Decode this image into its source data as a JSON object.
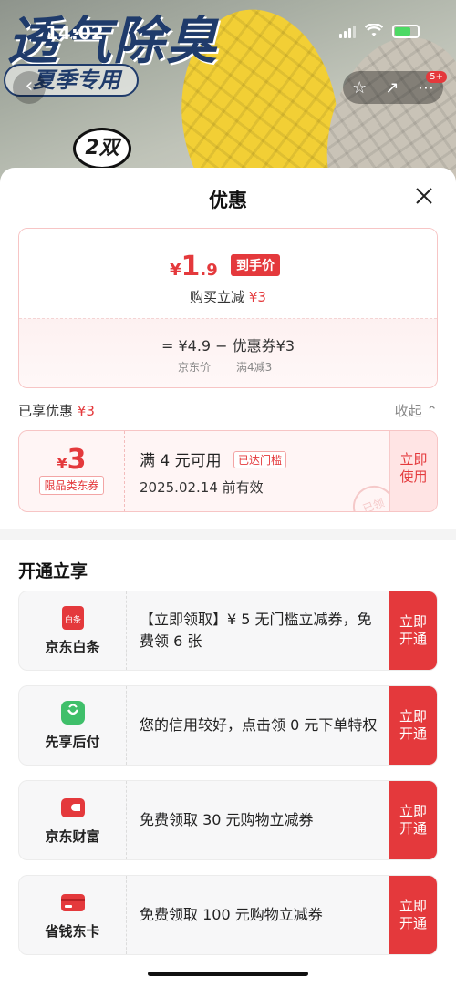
{
  "status_bar": {
    "time": "14:02"
  },
  "hero": {
    "title": "透气除臭",
    "season_tag": "夏季专用",
    "pair_badge": "2双",
    "message_badge": "5+"
  },
  "sheet": {
    "title": "优惠",
    "price": {
      "yen": "¥",
      "int": "1",
      "dec": ".9",
      "tag": "到手价",
      "buy_reduce_label": "购买立减",
      "buy_reduce_value": "¥3",
      "calc": "= ¥4.9 − 优惠券¥3",
      "calc_sub_left": "京东价",
      "calc_sub_right": "满4减3"
    },
    "enjoyed": {
      "label": "已享优惠",
      "value": "¥3",
      "collapse": "收起 ⌃"
    },
    "coupon": {
      "yen": "¥",
      "amount": "3",
      "scope": "限品类东券",
      "condition": "满 4 元可用",
      "reached": "已达门槛",
      "valid": "2025.02.14 前有效",
      "use_button": "立即 使用",
      "stamp": "已领"
    },
    "open_section_title": "开通立享",
    "services": [
      {
        "name": "京东白条",
        "icon_text": "白条",
        "desc": "【立即领取】¥ 5 无门槛立减券，免费领 6 张",
        "button": "立即 开通",
        "color": "#e4393c"
      },
      {
        "name": "先享后付",
        "icon_text": "",
        "desc": "您的信用较好，点击领 0 元下单特权",
        "button": "立即 开通",
        "color": "#3fbf6a"
      },
      {
        "name": "京东财富",
        "icon_text": "",
        "desc": "免费领取 30 元购物立减券",
        "button": "立即 开通",
        "color": "#e4393c"
      },
      {
        "name": "省钱东卡",
        "icon_text": "",
        "desc": "免费领取 100 元购物立减券",
        "button": "立即 开通",
        "color": "#e4393c"
      }
    ]
  }
}
